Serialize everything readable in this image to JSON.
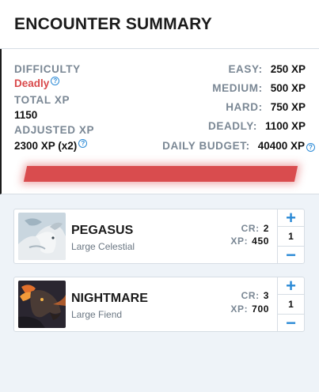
{
  "header": {
    "title": "ENCOUNTER SUMMARY"
  },
  "summary": {
    "difficulty_label": "DIFFICULTY",
    "difficulty_value": "Deadly",
    "total_xp_label": "TOTAL XP",
    "total_xp_value": "1150",
    "adjusted_xp_label": "ADJUSTED XP",
    "adjusted_xp_value": "2300 XP (x2)",
    "help_glyph": "?",
    "thresholds": [
      {
        "label": "EASY:",
        "value": "250 XP"
      },
      {
        "label": "MEDIUM:",
        "value": "500 XP"
      },
      {
        "label": "HARD:",
        "value": "750 XP"
      },
      {
        "label": "DEADLY:",
        "value": "1100 XP"
      },
      {
        "label": "DAILY BUDGET:",
        "value": "40400 XP"
      }
    ],
    "difficulty_bar_color": "#d94c4e"
  },
  "monsters": [
    {
      "name": "PEGASUS",
      "type": "Large Celestial",
      "cr_label": "CR:",
      "cr": "2",
      "xp_label": "XP:",
      "xp": "450",
      "qty": "1",
      "plus": "+",
      "minus": "−"
    },
    {
      "name": "NIGHTMARE",
      "type": "Large Fiend",
      "cr_label": "CR:",
      "cr": "3",
      "xp_label": "XP:",
      "xp": "700",
      "qty": "1",
      "plus": "+",
      "minus": "−"
    }
  ],
  "colors": {
    "accent": "#2b8ad6",
    "danger": "#d9484a",
    "label": "#7a8794"
  }
}
